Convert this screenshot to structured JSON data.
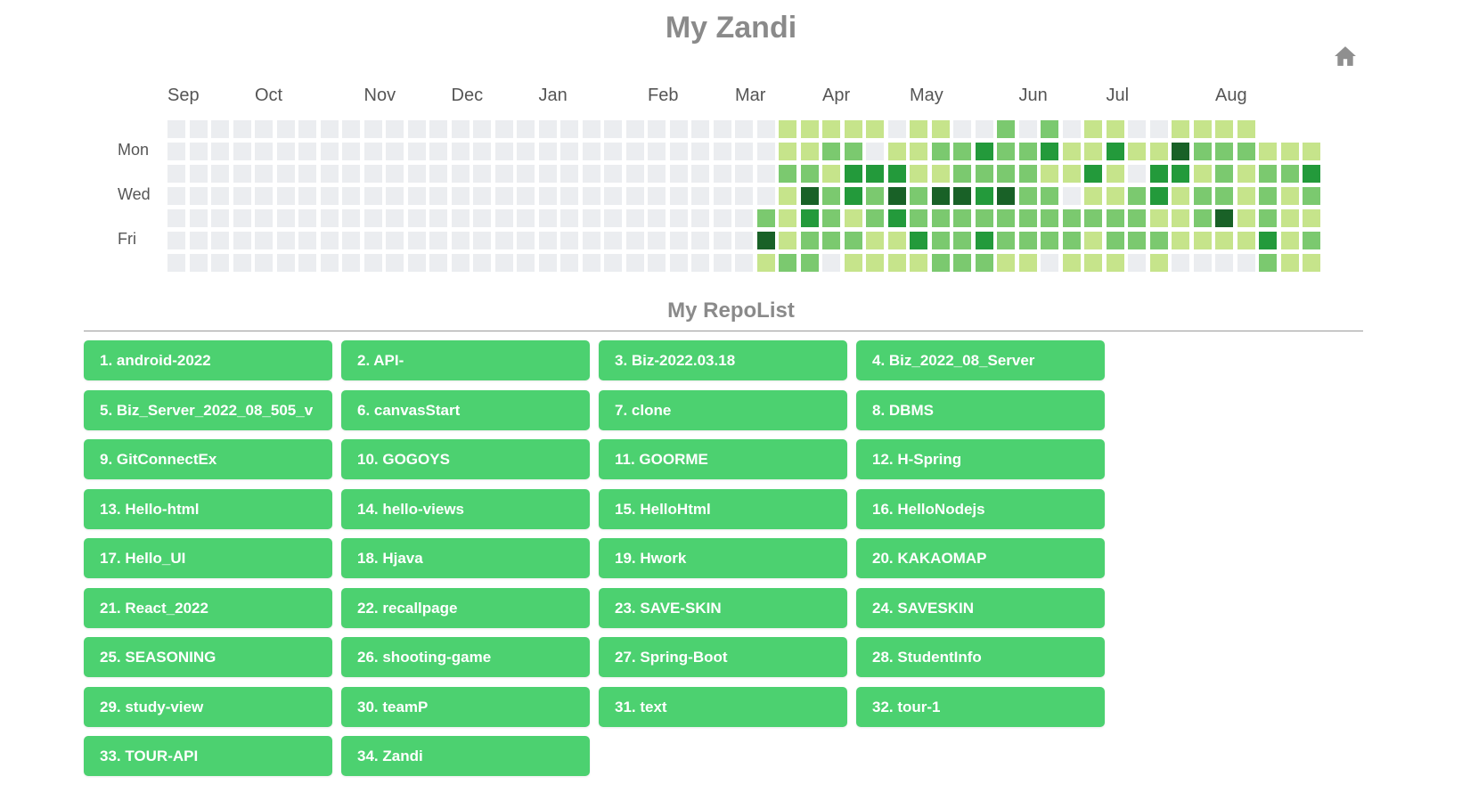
{
  "header": {
    "title": "My Zandi",
    "home_icon": "home-icon"
  },
  "heatmap": {
    "months": [
      {
        "label": "Sep",
        "col": 0
      },
      {
        "label": "Oct",
        "col": 4
      },
      {
        "label": "Nov",
        "col": 9
      },
      {
        "label": "Dec",
        "col": 13
      },
      {
        "label": "Jan",
        "col": 17
      },
      {
        "label": "Feb",
        "col": 22
      },
      {
        "label": "Mar",
        "col": 26
      },
      {
        "label": "Apr",
        "col": 30
      },
      {
        "label": "May",
        "col": 34
      },
      {
        "label": "Jun",
        "col": 39
      },
      {
        "label": "Jul",
        "col": 43
      },
      {
        "label": "Aug",
        "col": 48
      }
    ],
    "day_labels": [
      {
        "label": "Mon",
        "row": 1
      },
      {
        "label": "Wed",
        "row": 3
      },
      {
        "label": "Fri",
        "row": 5
      }
    ],
    "colors": [
      "#ebedf0",
      "#c6e48b",
      "#7bc96f",
      "#239a3b",
      "#196127"
    ],
    "levels": [
      "00000000000000000000000000001111101100202011001111",
      "00000000000000000000000000001122011223223113114222111",
      "00000000000000000000000000002213331122221131033121223",
      "00000000000000000000000000001423242443422011231221212",
      "00000000000000000000000000021321232222222222211241211",
      "00000000000000000000000000041222113223222212221111312",
      "00000000000000000000000000012201111222110111010000211"
    ]
  },
  "repolist": {
    "title": "My RepoList",
    "items": [
      "1. android-2022",
      "2. API-",
      "3. Biz-2022.03.18",
      "4. Biz_2022_08_Server",
      "5. Biz_Server_2022_08_505_v",
      "6. canvasStart",
      "7. clone",
      "8. DBMS",
      "9. GitConnectEx",
      "10. GOGOYS",
      "11. GOORME",
      "12. H-Spring",
      "13. Hello-html",
      "14. hello-views",
      "15. HelloHtml",
      "16. HelloNodejs",
      "17. Hello_UI",
      "18. Hjava",
      "19. Hwork",
      "20. KAKAOMAP",
      "21. React_2022",
      "22. recallpage",
      "23. SAVE-SKIN",
      "24. SAVESKIN",
      "25. SEASONING",
      "26. shooting-game",
      "27. Spring-Boot",
      "28. StudentInfo",
      "29. study-view",
      "30. teamP",
      "31. text",
      "32. tour-1",
      "33. TOUR-API",
      "34. Zandi"
    ]
  }
}
